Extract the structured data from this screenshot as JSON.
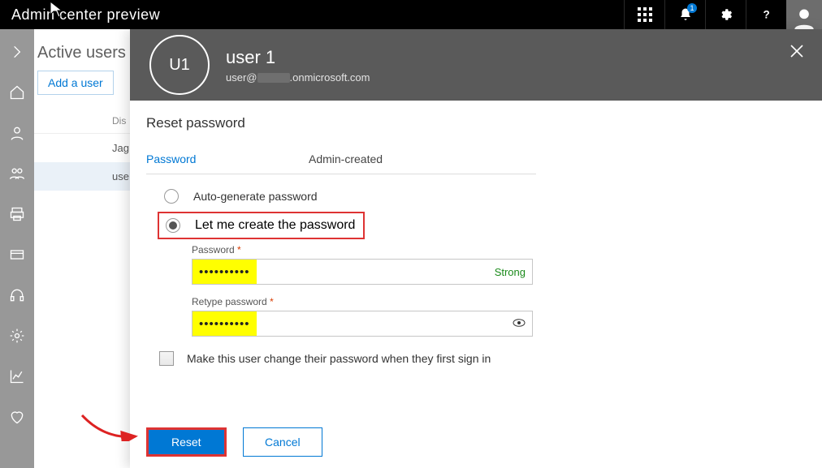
{
  "topbar": {
    "title": "Admin center preview",
    "notification_count": "1"
  },
  "page": {
    "title": "Active users",
    "add_user_label": "Add a user",
    "column_display": "Dis",
    "rows": [
      "Jag",
      "use"
    ]
  },
  "panel": {
    "avatar_initials": "U1",
    "user_name": "user 1",
    "user_email_prefix": "user@",
    "user_email_suffix": ".onmicrosoft.com",
    "section_title": "Reset password",
    "password_field_label": "Password",
    "password_field_value": "Admin-created",
    "radio_auto": "Auto-generate password",
    "radio_manual": "Let me create the password",
    "pw_label": "Password",
    "retype_label": "Retype password",
    "required_mark": "*",
    "pw_dots": "••••••••••",
    "pw_dots2": "••••••••••",
    "strength_text": "Strong",
    "change_on_signin": "Make this user change their password when they first sign in",
    "reset_label": "Reset",
    "cancel_label": "Cancel"
  }
}
